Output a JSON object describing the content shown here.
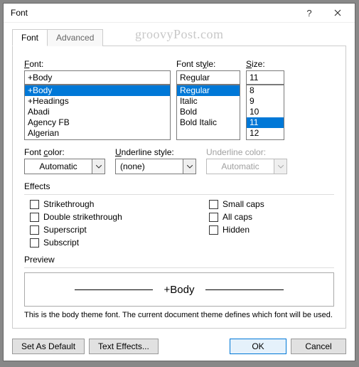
{
  "title": "Font",
  "watermark": "groovyPost.com",
  "tabs": {
    "font": "Font",
    "advanced": "Advanced"
  },
  "font_section": {
    "label": "Font:",
    "value": "+Body",
    "items": [
      "+Body",
      "+Headings",
      "Abadi",
      "Agency FB",
      "Algerian"
    ]
  },
  "style_section": {
    "label": "Font style:",
    "value": "Regular",
    "items": [
      "Regular",
      "Italic",
      "Bold",
      "Bold Italic"
    ]
  },
  "size_section": {
    "label": "Size:",
    "value": "11",
    "items": [
      "8",
      "9",
      "10",
      "11",
      "12"
    ]
  },
  "font_color": {
    "label": "Font color:",
    "value": "Automatic"
  },
  "underline_style": {
    "label": "Underline style:",
    "value": "(none)"
  },
  "underline_color": {
    "label": "Underline color:",
    "value": "Automatic"
  },
  "effects": {
    "label": "Effects",
    "strikethrough": "Strikethrough",
    "double_strikethrough": "Double strikethrough",
    "superscript": "Superscript",
    "subscript": "Subscript",
    "small_caps": "Small caps",
    "all_caps": "All caps",
    "hidden": "Hidden"
  },
  "preview": {
    "label": "Preview",
    "text": "+Body",
    "desc": "This is the body theme font. The current document theme defines which font will be used."
  },
  "buttons": {
    "set_default": "Set As Default",
    "text_effects": "Text Effects...",
    "ok": "OK",
    "cancel": "Cancel"
  }
}
